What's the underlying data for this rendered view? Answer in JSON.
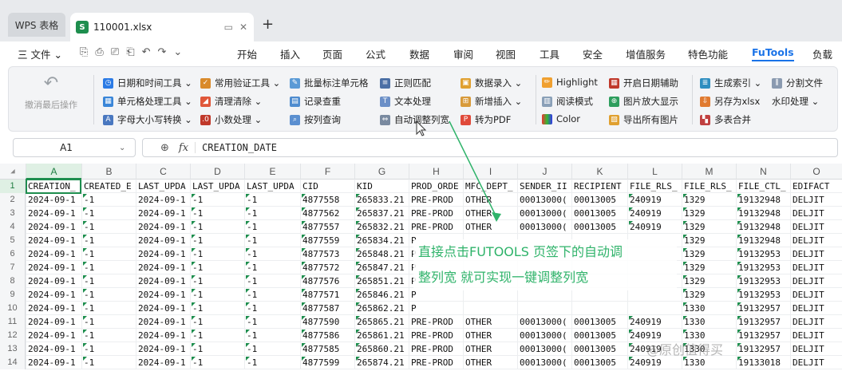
{
  "titlebar": {
    "app_tab": "WPS 表格",
    "file_tab": "110001.xlsx",
    "file_badge": "S",
    "new_tab": "+"
  },
  "menubar": {
    "file_menu": "三 文件 ⌄",
    "items": [
      "开始",
      "插入",
      "页面",
      "公式",
      "数据",
      "审阅",
      "视图",
      "工具",
      "安全",
      "增值服务",
      "特色功能",
      "FuTools",
      "负载"
    ],
    "active": "FuTools"
  },
  "ribbon": {
    "undo_label": "撤消最后操作",
    "col1": [
      "日期和时间工具 ⌄",
      "单元格处理工具 ⌄",
      "字母大小写转换 ⌄"
    ],
    "col2": [
      "常用验证工具 ⌄",
      "清理清除 ⌄",
      "小数处理 ⌄"
    ],
    "col3": [
      "批量标注单元格",
      "记录查重",
      "按列查询"
    ],
    "col4": [
      "正则匹配",
      "文本处理",
      "自动调整列宽"
    ],
    "col5": [
      "数据录入 ⌄",
      "新增插入 ⌄",
      "转为PDF"
    ],
    "col6": [
      "Highlight",
      "阅读模式",
      "Color"
    ],
    "col7": [
      "开启日期辅助",
      "图片放大显示",
      "导出所有图片"
    ],
    "col8": [
      "生成索引 ⌄",
      "另存为xlsx",
      "多表合并"
    ],
    "col9": [
      "分割文件",
      "水印处理 ⌄"
    ]
  },
  "formula_bar": {
    "cell_ref": "A1",
    "formula": "CREATION_DATE"
  },
  "grid": {
    "columns": [
      "A",
      "B",
      "C",
      "D",
      "E",
      "F",
      "G",
      "H",
      "I",
      "J",
      "K",
      "L",
      "M",
      "N",
      "O"
    ],
    "header_row": [
      "CREATION_",
      "CREATED_E",
      "LAST_UPDA",
      "LAST_UPDA",
      "LAST_UPDA",
      "CID",
      "KID",
      "PROD_ORDE",
      "MFC_DEPT_",
      "SENDER_II",
      "RECIPIENT",
      "FILE_RLS_",
      "FILE_RLS_",
      "FILE_CTL_",
      "EDIFACT"
    ],
    "rows": [
      [
        "2024-09-1",
        "-1",
        "2024-09-1",
        "-1",
        "-1",
        "4877558",
        "265833.21",
        "PRE-PROD",
        "OTHER",
        "00013000(",
        "00013005",
        "240919",
        "1329",
        "19132948",
        "DELJIT"
      ],
      [
        "2024-09-1",
        "-1",
        "2024-09-1",
        "-1",
        "-1",
        "4877562",
        "265837.21",
        "PRE-PROD",
        "OTHER",
        "00013000(",
        "00013005",
        "240919",
        "1329",
        "19132948",
        "DELJIT"
      ],
      [
        "2024-09-1",
        "-1",
        "2024-09-1",
        "-1",
        "-1",
        "4877557",
        "265832.21",
        "PRE-PROD",
        "OTHER",
        "00013000(",
        "00013005",
        "240919",
        "1329",
        "19132948",
        "DELJIT"
      ],
      [
        "2024-09-1",
        "-1",
        "2024-09-1",
        "-1",
        "-1",
        "4877559",
        "265834.21",
        "P",
        "",
        "",
        "",
        "",
        "1329",
        "19132948",
        "DELJIT"
      ],
      [
        "2024-09-1",
        "-1",
        "2024-09-1",
        "-1",
        "-1",
        "4877573",
        "265848.21",
        "P",
        "",
        "",
        "",
        "",
        "1329",
        "19132953",
        "DELJIT"
      ],
      [
        "2024-09-1",
        "-1",
        "2024-09-1",
        "-1",
        "-1",
        "4877572",
        "265847.21",
        "P",
        "",
        "",
        "",
        "",
        "1329",
        "19132953",
        "DELJIT"
      ],
      [
        "2024-09-1",
        "-1",
        "2024-09-1",
        "-1",
        "-1",
        "4877576",
        "265851.21",
        "P",
        "",
        "",
        "",
        "",
        "1329",
        "19132953",
        "DELJIT"
      ],
      [
        "2024-09-1",
        "-1",
        "2024-09-1",
        "-1",
        "-1",
        "4877571",
        "265846.21",
        "P",
        "",
        "",
        "",
        "",
        "1329",
        "19132953",
        "DELJIT"
      ],
      [
        "2024-09-1",
        "-1",
        "2024-09-1",
        "-1",
        "-1",
        "4877587",
        "265862.21",
        "P",
        "",
        "",
        "",
        "",
        "1330",
        "19132957",
        "DELJIT"
      ],
      [
        "2024-09-1",
        "-1",
        "2024-09-1",
        "-1",
        "-1",
        "4877590",
        "265865.21",
        "PRE-PROD",
        "OTHER",
        "00013000(",
        "00013005",
        "240919",
        "1330",
        "19132957",
        "DELJIT"
      ],
      [
        "2024-09-1",
        "-1",
        "2024-09-1",
        "-1",
        "-1",
        "4877586",
        "265861.21",
        "PRE-PROD",
        "OTHER",
        "00013000(",
        "00013005",
        "240919",
        "1330",
        "19132957",
        "DELJIT"
      ],
      [
        "2024-09-1",
        "-1",
        "2024-09-1",
        "-1",
        "-1",
        "4877585",
        "265860.21",
        "PRE-PROD",
        "OTHER",
        "00013000(",
        "00013005",
        "240919",
        "1330",
        "19132957",
        "DELJIT"
      ],
      [
        "2024-09-1",
        "-1",
        "2024-09-1",
        "-1",
        "-1",
        "4877599",
        "265874.21",
        "PRE-PROD",
        "OTHER",
        "00013000(",
        "00013005",
        "240919",
        "1330",
        "19133018",
        "DELJIT"
      ]
    ]
  },
  "annotation": {
    "line1": "直接点击FUTOOLS 页签下的自动调",
    "line2": "整列宽 就可实现一键调整列宽"
  },
  "watermark": "@原创值得买"
}
